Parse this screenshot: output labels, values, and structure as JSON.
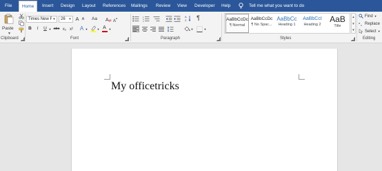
{
  "tabs": [
    {
      "label": "File"
    },
    {
      "label": "Home"
    },
    {
      "label": "Insert"
    },
    {
      "label": "Design"
    },
    {
      "label": "Layout"
    },
    {
      "label": "References"
    },
    {
      "label": "Mailings"
    },
    {
      "label": "Review"
    },
    {
      "label": "View"
    },
    {
      "label": "Developer"
    },
    {
      "label": "Help"
    }
  ],
  "active_tab": "Home",
  "tell_me": "Tell me what you want to do",
  "colors": {
    "accent": "#2b579a",
    "ribbon_bg": "#f3f3f3",
    "workspace_bg": "#e6e6e6",
    "font_color_bar": "#d40000",
    "highlight_bar": "#ffff00"
  },
  "ribbon": {
    "clipboard": {
      "paste_label": "Paste",
      "group_label": "Clipboard"
    },
    "font": {
      "font_name": "Times New Ro",
      "font_size": "26",
      "grow_label": "A",
      "shrink_label": "A",
      "case_label": "Aa",
      "bold": "B",
      "italic": "I",
      "underline": "U",
      "strike": "abc",
      "subscript": "x₂",
      "superscript": "x²",
      "text_effects": "A",
      "font_color": "A",
      "group_label": "Font"
    },
    "paragraph": {
      "group_label": "Paragraph"
    },
    "styles": {
      "items": [
        {
          "preview": "AaBbCcDc",
          "name": "¶ Normal",
          "selected": true
        },
        {
          "preview": "AaBbCcDc",
          "name": "¶ No Spac...",
          "selected": false
        },
        {
          "preview": "AaBbCc",
          "name": "Heading 1",
          "selected": false
        },
        {
          "preview": "AaBbCcI",
          "name": "Heading 2",
          "selected": false
        },
        {
          "preview": "AaB",
          "name": "Title",
          "selected": false
        }
      ],
      "group_label": "Styles"
    },
    "editing": {
      "find": "Find",
      "replace": "Replace",
      "select": "Select",
      "group_label": "Editing"
    }
  },
  "document": {
    "text": "My officetricks"
  }
}
